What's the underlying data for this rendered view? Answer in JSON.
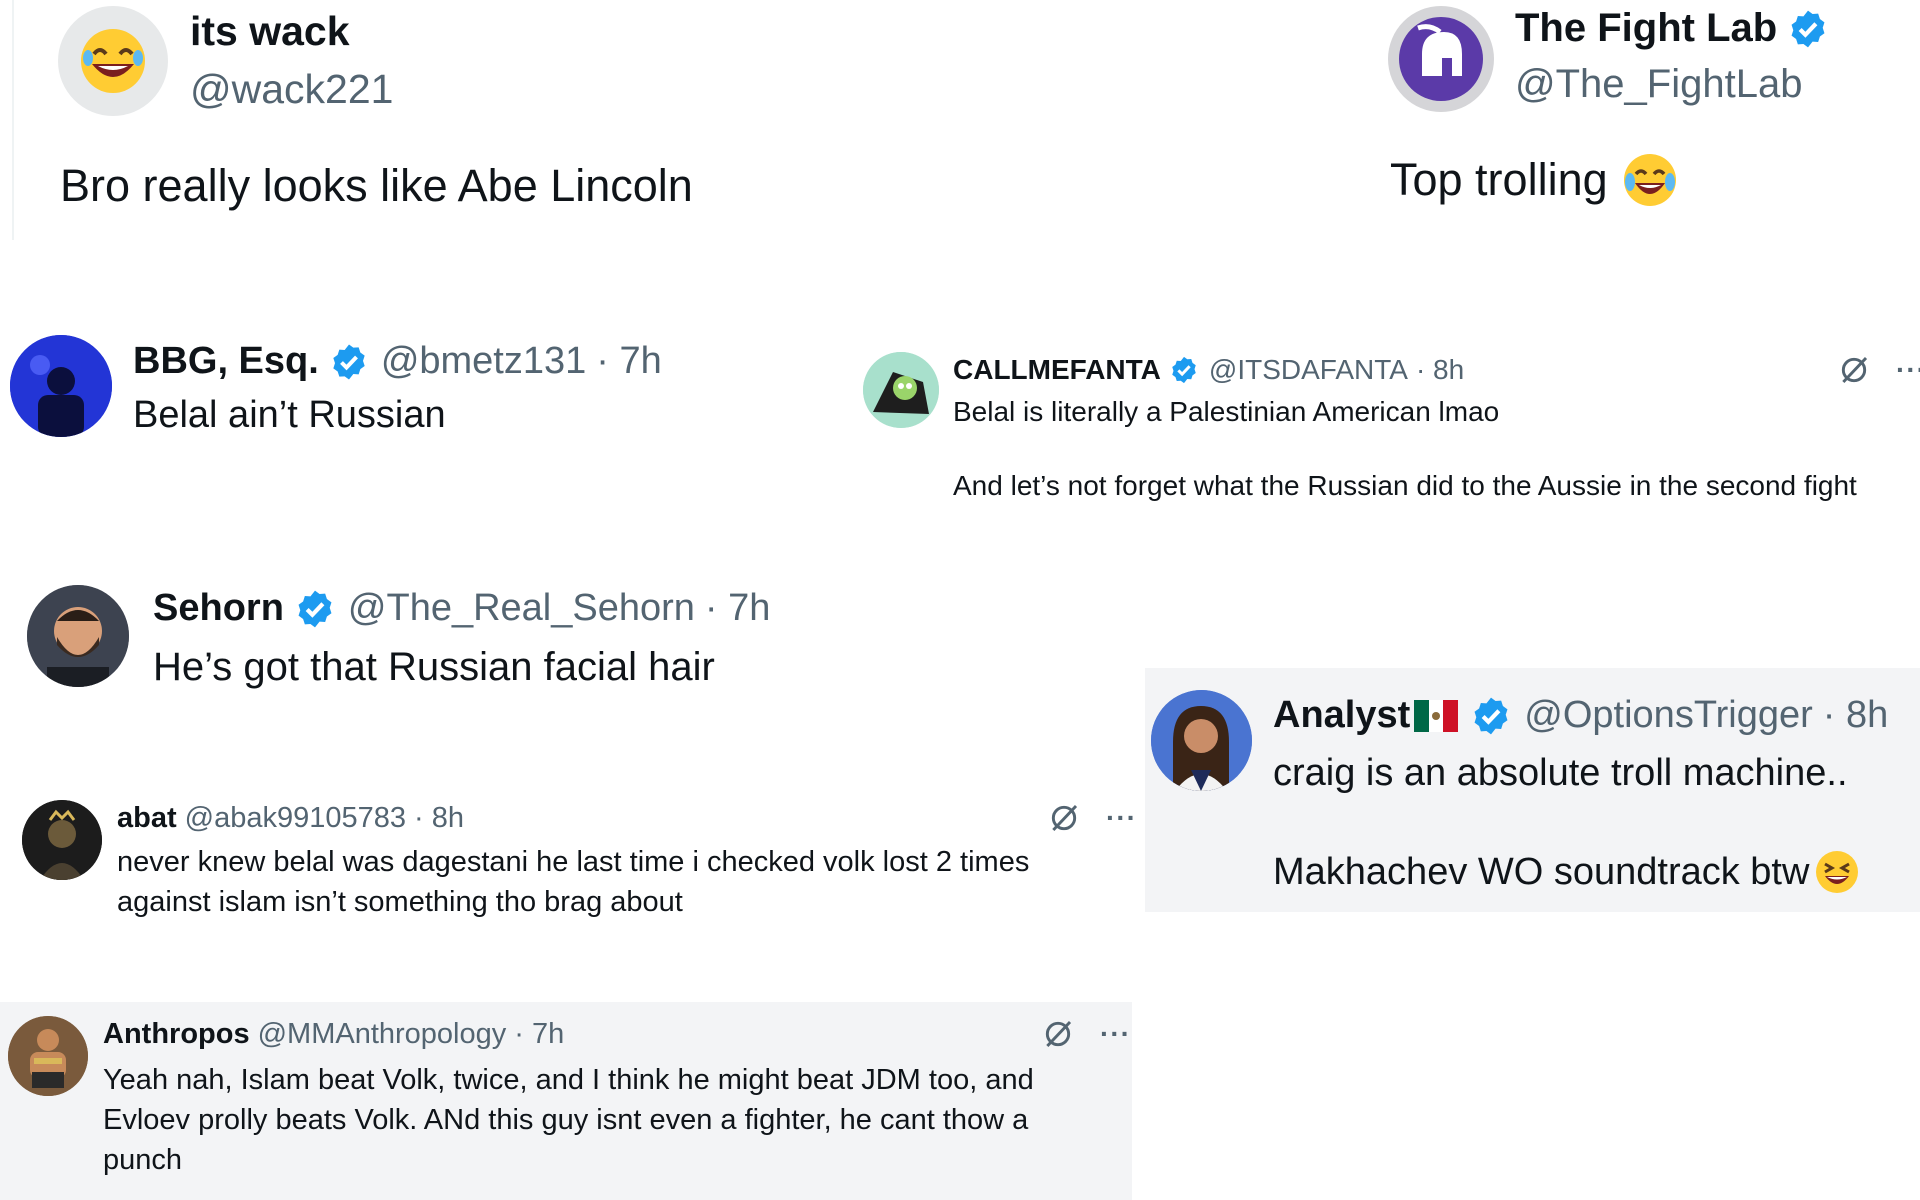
{
  "tweets": [
    {
      "name": "its wack",
      "handle": "@wack221",
      "text": "Bro really looks like Abe Lincoln",
      "avatar_icon": "laughing-emoji-avatar"
    },
    {
      "name": "The Fight Lab",
      "handle": "@The_FightLab",
      "text": "Top trolling",
      "text_emoji": "tears-of-joy-emoji",
      "avatar_icon": "spartan-helmet-logo"
    },
    {
      "name": "BBG, Esq.",
      "handle": "@bmetz131",
      "time": "· 7h",
      "text": "Belal ain’t Russian",
      "avatar_icon": "dark-blue-photo-avatar"
    },
    {
      "name": "CALLMEFANTA",
      "handle": "@ITSDAFANTA",
      "time": "· 8h",
      "text_line1": "Belal is literally a Palestinian American lmao",
      "text_line2": "And let’s not forget what the Russian did to the Aussie in the second fight",
      "avatar_icon": "cartoon-avatar"
    },
    {
      "name": "Sehorn",
      "handle": "@The_Real_Sehorn",
      "time": "· 7h",
      "text": "He’s got that Russian facial hair",
      "avatar_icon": "bearded-man-avatar"
    },
    {
      "name": "Analyst",
      "name_flag": "mexico-flag-icon",
      "handle": "@OptionsTrigger",
      "time": "· 8h",
      "text_line1": "craig is an absolute troll machine..",
      "text_line2": "Makhachev WO soundtrack btw",
      "text_emoji": "grinning-squinting-emoji",
      "avatar_icon": "woman-portrait-avatar"
    },
    {
      "name": "abat",
      "handle": "@abak99105783",
      "time": "· 8h",
      "text_line1": "never knew belal was dagestani he last time i checked volk lost 2 times",
      "text_line2": "against islam isn’t something tho brag about",
      "avatar_icon": "black-white-avatar"
    },
    {
      "name": "Anthropos",
      "handle": "@MMAnthropology",
      "time": "· 7h",
      "text_line1": "Yeah nah, Islam beat Volk, twice, and I think he might beat JDM too, and",
      "text_line2": "Evloev prolly beats Volk. ANd this guy isnt even a fighter, he cant thow a",
      "text_line3": "punch",
      "avatar_icon": "fighter-photo-avatar"
    }
  ],
  "more_label": "···",
  "colors": {
    "verified": "#1d9bf0",
    "text": "#0f1419",
    "muted": "#536471",
    "highlight_bg": "#f3f4f6"
  }
}
